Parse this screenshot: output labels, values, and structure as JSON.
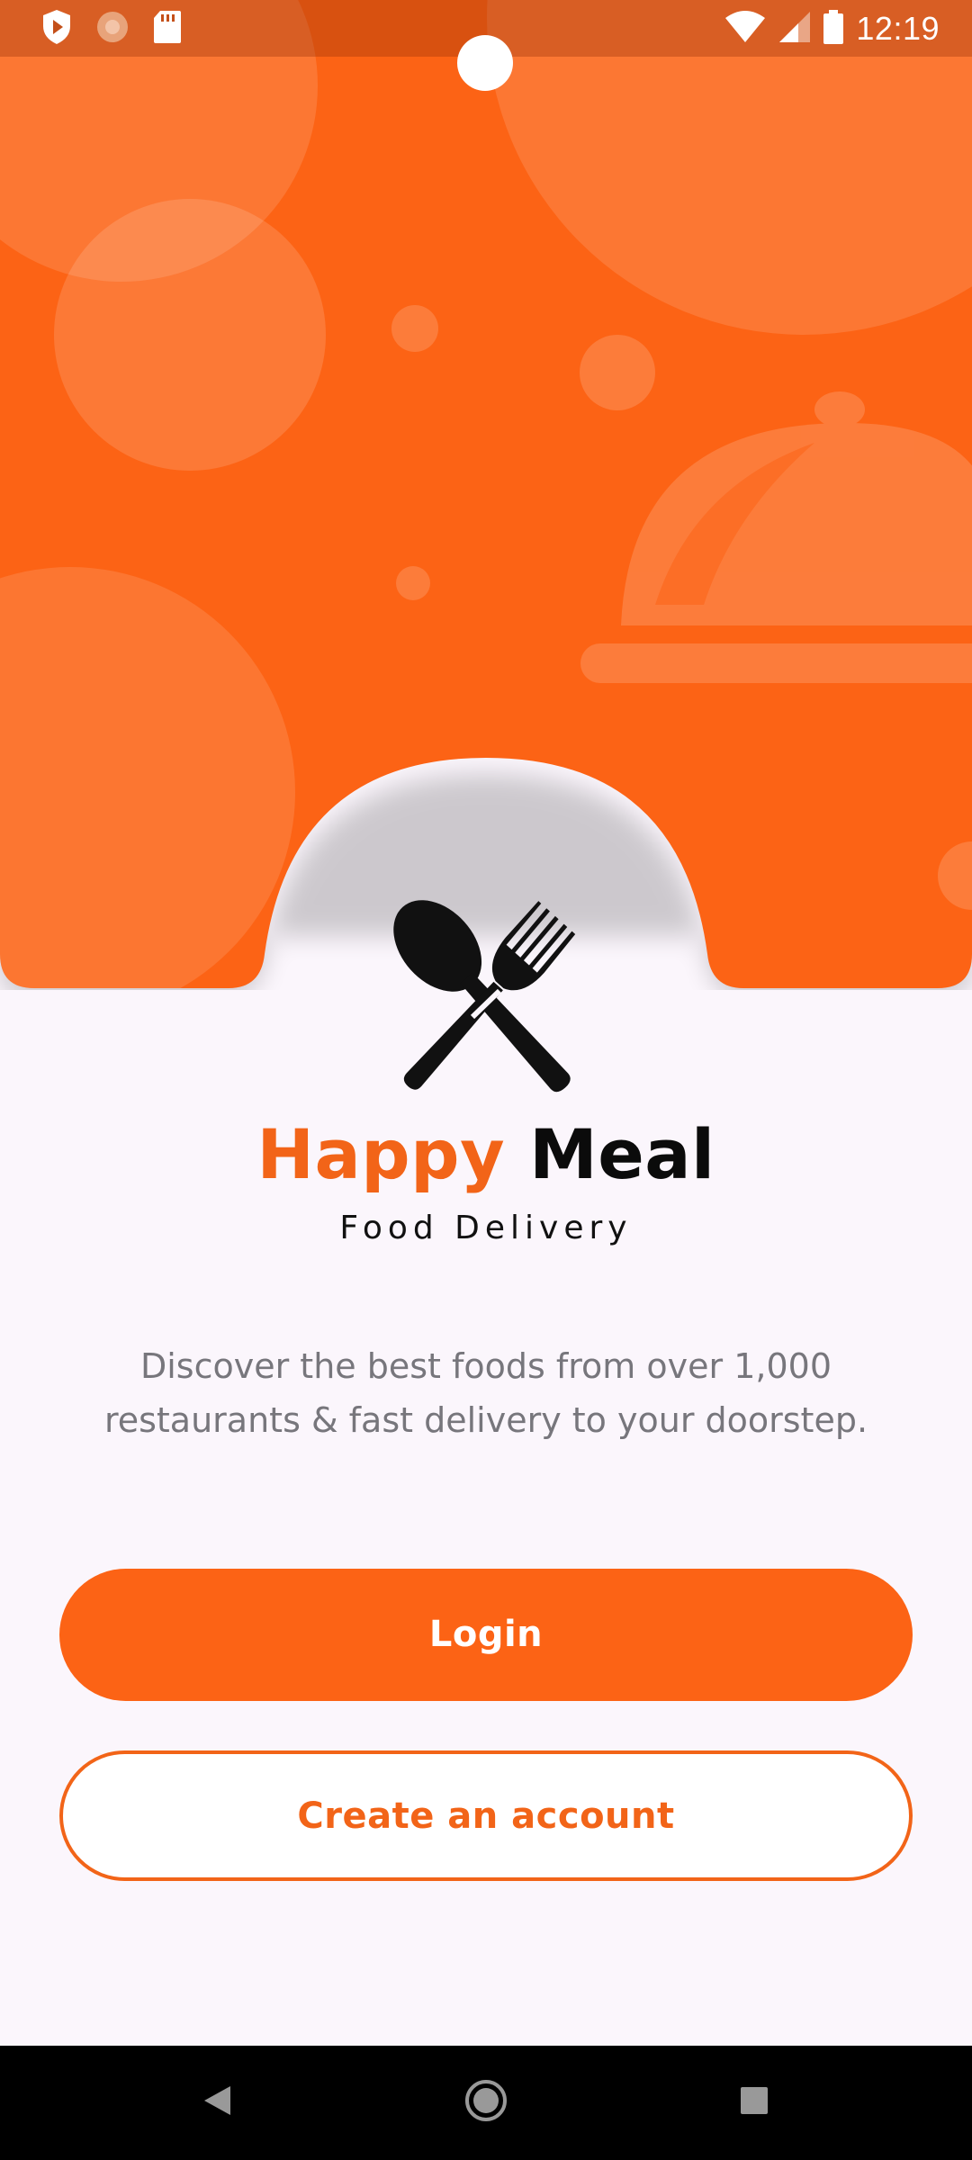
{
  "status_bar": {
    "time": "12:19",
    "icons_left": [
      "shield-play-icon",
      "loading-icon",
      "sd-card-icon"
    ],
    "icons_right": [
      "wifi-icon",
      "signal-icon",
      "battery-icon"
    ]
  },
  "brand": {
    "word1": "Happy",
    "word2": "Meal",
    "tagline": "Food Delivery",
    "logo_icon": "spoon-fork-icon"
  },
  "description": "Discover the best foods from over 1,000 restaurants & fast delivery to your doorstep.",
  "buttons": {
    "login": "Login",
    "create_account": "Create an account"
  },
  "nav": {
    "items": [
      "back-icon",
      "home-icon",
      "recents-icon"
    ]
  },
  "colors": {
    "primary": "#FC6315",
    "brand_orange": "#F26418",
    "background": "#FBF6FC",
    "text_muted": "#77767c"
  }
}
